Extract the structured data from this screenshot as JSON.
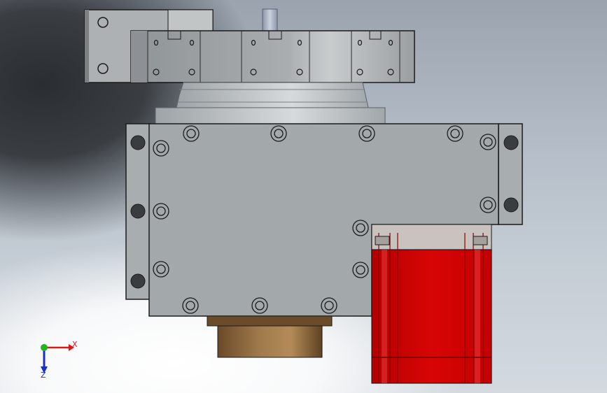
{
  "triad": {
    "x_label": "X",
    "z_label": "Z",
    "x_color": "#d21b1b",
    "y_color": "#21b521",
    "z_color": "#1a2fc9"
  },
  "colors": {
    "housing": "#a3a8ab",
    "housing_dark": "#8a8f93",
    "motor_red": "#d40000",
    "motor_cap": "#c7c0bd",
    "shaft_bronze": "#8a6640",
    "outline": "#1b1b1b"
  }
}
